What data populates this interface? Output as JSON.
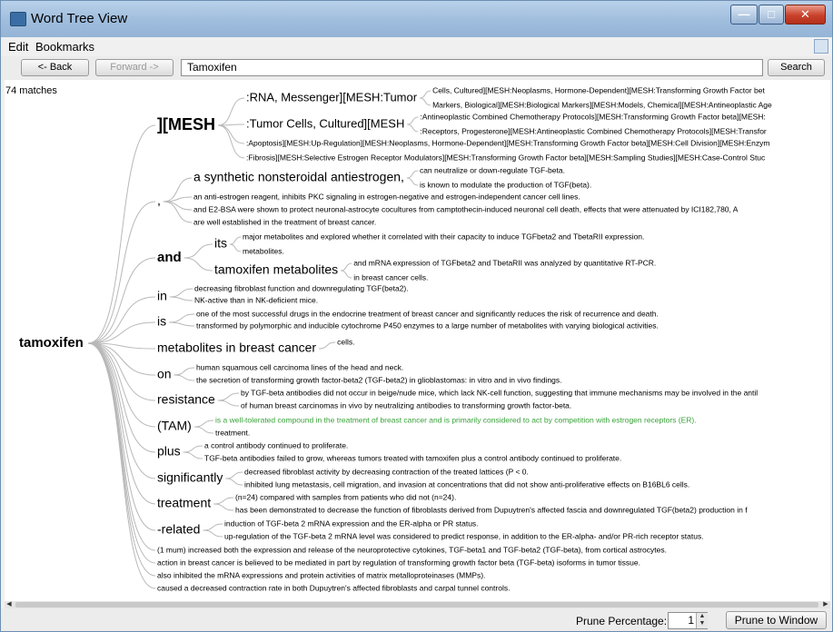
{
  "window": {
    "title": "Word Tree View"
  },
  "menu": {
    "items": [
      "Edit",
      "Bookmarks"
    ]
  },
  "toolbar": {
    "back_label": "<- Back",
    "forward_label": "Forward ->",
    "search_value": "Tamoxifen",
    "search_label": "Search"
  },
  "tree": {
    "match_count": "74 matches",
    "root": "tamoxifen",
    "nodes": [
      {
        "label": "][MESH",
        "children": [
          {
            "label": ":RNA, Messenger][MESH:Tumor",
            "children": [
              "Cells, Cultured][MESH:Neoplasms, Hormone-Dependent][MESH:Transforming Growth Factor bet",
              "Markers, Biological][MESH:Biological Markers][MESH:Models, Chemical][MESH:Antineoplastic Age"
            ]
          },
          {
            "label": ":Tumor Cells, Cultured][MESH",
            "children": [
              ":Antineoplastic Combined Chemotherapy Protocols][MESH:Transforming Growth Factor beta][MESH:",
              ":Receptors, Progesterone][MESH:Antineoplastic Combined Chemotherapy Protocols][MESH:Transfor"
            ]
          },
          {
            "label": ":Apoptosis][MESH:Up-Regulation][MESH:Neoplasms, Hormone-Dependent][MESH:Transforming Growth Factor beta][MESH:Cell Division][MESH:Enzym",
            "children": []
          },
          {
            "label": ":Fibrosis][MESH:Selective Estrogen Receptor Modulators][MESH:Transforming Growth Factor beta][MESH:Sampling Studies][MESH:Case-Control Stuc",
            "children": []
          }
        ]
      },
      {
        "label": ",",
        "children": [
          {
            "label": "a synthetic nonsteroidal antiestrogen,",
            "children": [
              "can neutralize or down-regulate TGF-beta.",
              "is known to modulate the production of TGF(beta)."
            ]
          },
          {
            "label": "an anti-estrogen reagent, inhibits PKC signaling in estrogen-negative and estrogen-independent cancer cell lines.",
            "children": []
          },
          {
            "label": "and E2-BSA were shown to protect neuronal-astrocyte cocultures from camptothecin-induced neuronal cell death, effects that were attenuated by ICI182,780, A",
            "children": []
          },
          {
            "label": "are well established in the treatment of breast cancer.",
            "children": []
          }
        ]
      },
      {
        "label": "and",
        "children": [
          {
            "label": "its",
            "children": [
              "major metabolites and explored whether it correlated with their capacity to induce TGFbeta2 and TbetaRII expression.",
              "metabolites."
            ]
          },
          {
            "label": "tamoxifen metabolites",
            "children": [
              "and mRNA expression of TGFbeta2 and TbetaRII was analyzed by quantitative RT-PCR.",
              "in breast cancer cells."
            ]
          }
        ]
      },
      {
        "label": "in",
        "children": [
          "decreasing fibroblast function and downregulating TGF(beta2).",
          "NK-active than in NK-deficient mice."
        ]
      },
      {
        "label": "is",
        "children": [
          "one of the most successful drugs in the endocrine treatment of breast cancer and significantly reduces the risk of recurrence and death.",
          "transformed by polymorphic and inducible cytochrome P450 enzymes to a large number of metabolites with varying biological activities."
        ]
      },
      {
        "label": "metabolites in breast cancer",
        "children": [
          "cells."
        ]
      },
      {
        "label": "on",
        "children": [
          "human squamous cell carcinoma lines of the head and neck.",
          "the secretion of transforming growth factor-beta2 (TGF-beta2) in glioblastomas: in vitro and in vivo findings."
        ]
      },
      {
        "label": "resistance",
        "children": [
          "by TGF-beta antibodies did not occur in beige/nude mice, which lack NK-cell function, suggesting that immune mechanisms may be involved in the antil",
          "of human breast carcinomas in vivo by neutralizing antibodies to transforming growth factor-beta."
        ]
      },
      {
        "label": "(TAM)",
        "children": [
          "is a well-tolerated compound in the treatment of breast cancer and is primarily considered to act by competition with estrogen receptors (ER).",
          "treatment."
        ]
      },
      {
        "label": "plus",
        "children": [
          "a control antibody continued to proliferate.",
          "TGF-beta antibodies failed to grow, whereas tumors treated with tamoxifen plus a control antibody continued to proliferate."
        ]
      },
      {
        "label": "significantly",
        "children": [
          "decreased fibroblast activity by decreasing contraction of the treated lattices (P < 0.",
          "inhibited lung metastasis, cell migration, and invasion at concentrations that did not show anti-proliferative effects on B16BL6 cells."
        ]
      },
      {
        "label": "treatment",
        "children": [
          "(n=24) compared with samples from patients who did not (n=24).",
          "has been demonstrated to decrease the function of fibroblasts derived from Dupuytren's affected fascia and downregulated TGF(beta2) production in f"
        ]
      },
      {
        "label": "-related",
        "children": [
          "induction of TGF-beta 2 mRNA expression and the ER-alpha or PR status.",
          "up-regulation of the TGF-beta 2 mRNA level was considered to predict response, in addition to the ER-alpha- and/or PR-rich receptor status."
        ]
      },
      {
        "label": "(1 mum) increased both the expression and release of the neuroprotective cytokines, TGF-beta1 and TGF-beta2 (TGF-beta), from cortical astrocytes.",
        "children": []
      },
      {
        "label": "action in breast cancer is believed to be mediated in part by regulation of transforming growth factor beta (TGF-beta) isoforms in tumor tissue.",
        "children": []
      },
      {
        "label": "also inhibited the mRNA expressions and protein activities of matrix metalloproteinases (MMPs).",
        "children": []
      },
      {
        "label": "caused a decreased contraction rate in both Dupuytren's affected fibroblasts and carpal tunnel controls.",
        "children": []
      }
    ]
  },
  "colors": {
    "highlight_text": "#3aa23a",
    "text": "#000000",
    "branch": "#b8b8b8"
  },
  "status": {
    "prune_label": "Prune Percentage:",
    "prune_value": "1",
    "prune_button": "Prune to Window"
  }
}
